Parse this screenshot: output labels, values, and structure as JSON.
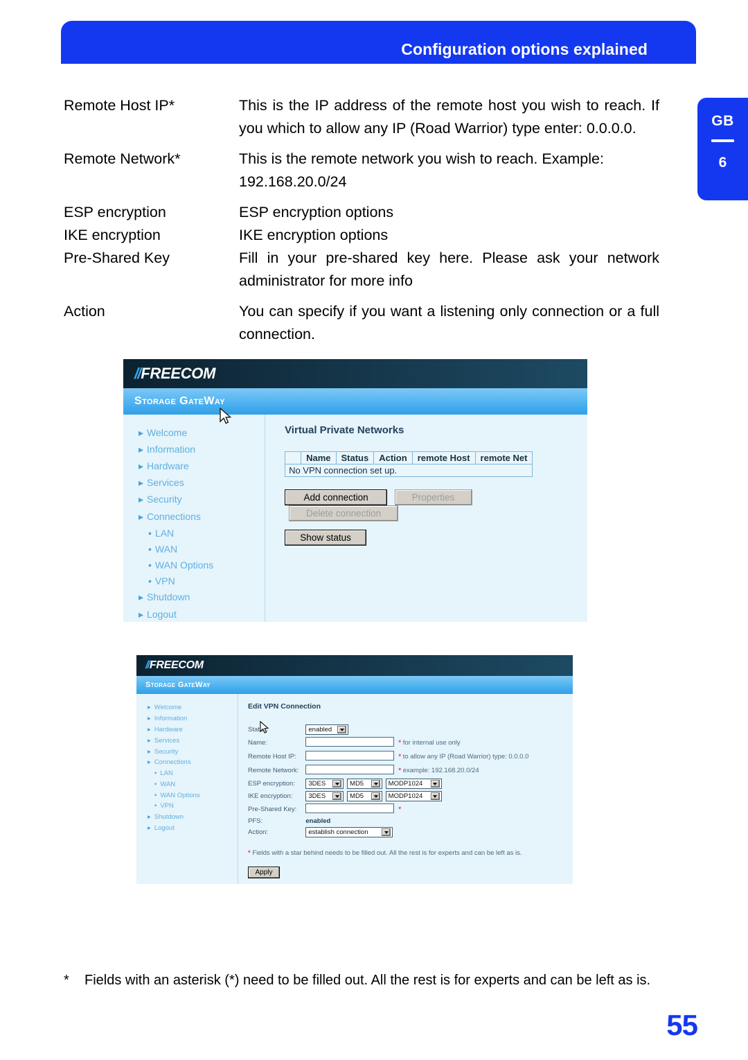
{
  "header": {
    "title": "Configuration options explained"
  },
  "side_tab": {
    "region": "GB",
    "chapter": "6"
  },
  "definitions": [
    {
      "term": "Remote Host IP*",
      "description": "This is the IP address of the remote host you wish to reach. If you which to allow any IP (Road Warrior) type enter: 0.0.0.0."
    },
    {
      "term": "Remote Network*",
      "description": "This is the remote network you wish to reach. Example: 192.168.20.0/24"
    },
    {
      "term": "ESP encryption",
      "description": "ESP encryption options"
    },
    {
      "term": "IKE encryption",
      "description": "IKE encryption options"
    },
    {
      "term": "Pre-Shared Key",
      "description": "Fill in your pre-shared key here. Please ask your network administrator for more info"
    },
    {
      "term": "Action",
      "description": "You can specify if you want a listening only connection or a full connection."
    }
  ],
  "screenshot_list": {
    "brand": "FREECOM",
    "brand_bars": "//",
    "product": "Storage GateWay",
    "nav": [
      {
        "label": "Welcome",
        "level": "top"
      },
      {
        "label": "Information",
        "level": "top"
      },
      {
        "label": "Hardware",
        "level": "top"
      },
      {
        "label": "Services",
        "level": "top"
      },
      {
        "label": "Security",
        "level": "top"
      },
      {
        "label": "Connections",
        "level": "top"
      },
      {
        "label": "LAN",
        "level": "sub"
      },
      {
        "label": "WAN",
        "level": "sub"
      },
      {
        "label": "WAN Options",
        "level": "sub"
      },
      {
        "label": "VPN",
        "level": "sub"
      },
      {
        "label": "Shutdown",
        "level": "top"
      },
      {
        "label": "Logout",
        "level": "top"
      }
    ],
    "pane_title": "Virtual Private Networks",
    "table": {
      "columns": [
        "",
        "Name",
        "Status",
        "Action",
        "remote Host",
        "remote Net"
      ],
      "empty_message": "No VPN connection set up."
    },
    "buttons": [
      {
        "label": "Add connection",
        "state": "enabled"
      },
      {
        "label": "Properties",
        "state": "disabled"
      },
      {
        "label": "Delete connection",
        "state": "disabled"
      },
      {
        "label": "Show status",
        "state": "enabled"
      }
    ]
  },
  "screenshot_form": {
    "brand": "FREECOM",
    "brand_bars": "//",
    "product": "Storage GateWay",
    "nav": [
      {
        "label": "Welcome",
        "level": "top"
      },
      {
        "label": "Information",
        "level": "top"
      },
      {
        "label": "Hardware",
        "level": "top"
      },
      {
        "label": "Services",
        "level": "top"
      },
      {
        "label": "Security",
        "level": "top"
      },
      {
        "label": "Connections",
        "level": "top"
      },
      {
        "label": "LAN",
        "level": "sub"
      },
      {
        "label": "WAN",
        "level": "sub"
      },
      {
        "label": "WAN Options",
        "level": "sub"
      },
      {
        "label": "VPN",
        "level": "sub"
      },
      {
        "label": "Shutdown",
        "level": "top"
      },
      {
        "label": "Logout",
        "level": "top"
      }
    ],
    "pane_title": "Edit VPN Connection",
    "fields": {
      "status": {
        "label": "Status:",
        "value": "enabled"
      },
      "name": {
        "label": "Name:",
        "value": "",
        "required": "*",
        "hint": "for internal use only"
      },
      "remote_host_ip": {
        "label": "Remote Host IP:",
        "value": "",
        "required": "*",
        "hint": "to allow any IP (Road Warrior) type: 0.0.0.0"
      },
      "remote_network": {
        "label": "Remote Network:",
        "value": "",
        "required": "*",
        "hint": "example: 192.168.20.0/24"
      },
      "esp_encryption": {
        "label": "ESP encryption:",
        "cipher": "3DES",
        "hash": "MD5",
        "group": "MODP1024"
      },
      "ike_encryption": {
        "label": "IKE encryption:",
        "cipher": "3DES",
        "hash": "MD5",
        "group": "MODP1024"
      },
      "pre_shared_key": {
        "label": "Pre-Shared Key:",
        "value": "",
        "required": "*"
      },
      "pfs": {
        "label": "PFS:",
        "value": "enabled"
      },
      "action": {
        "label": "Action:",
        "value": "establish connection"
      }
    },
    "note": {
      "marker": "*",
      "text": "Fields with a star behind needs to be filled out. All the rest is for experts and can be left as is."
    },
    "apply_button": "Apply"
  },
  "footnote": {
    "marker": "*",
    "text": "Fields with an asterisk (*) need to be filled out. All the rest is for experts and can be left as is."
  },
  "page_number": "55"
}
